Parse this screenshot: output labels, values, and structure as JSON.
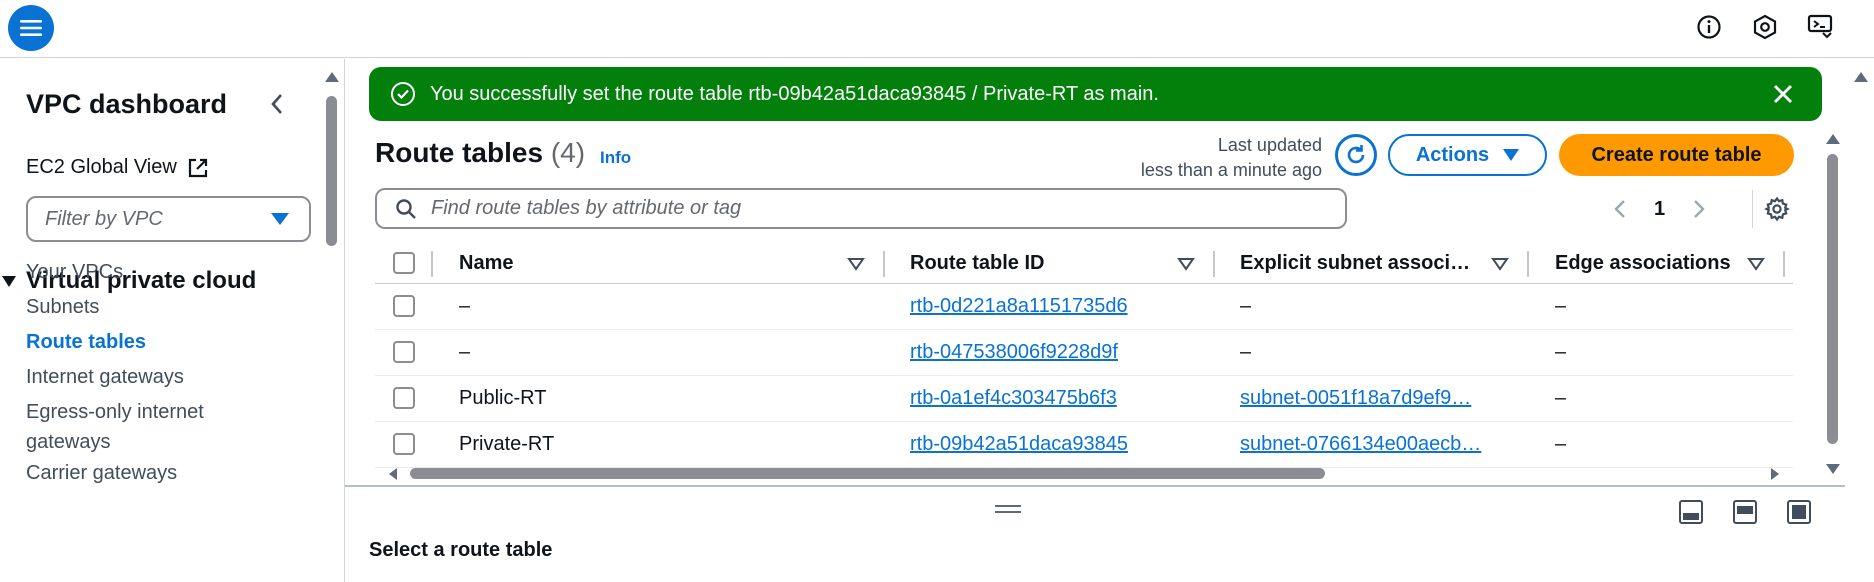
{
  "flash": {
    "message": "You successfully set the route table rtb-09b42a51daca93845 / Private-RT as main."
  },
  "sidebar": {
    "title": "VPC dashboard",
    "ec2_link": "EC2 Global View",
    "filter_placeholder": "Filter by VPC",
    "section_title": "Virtual private cloud",
    "items": [
      {
        "label": "Your VPCs"
      },
      {
        "label": "Subnets"
      },
      {
        "label": "Route tables",
        "active": true
      },
      {
        "label": "Internet gateways"
      },
      {
        "label": "Egress-only internet gateways"
      },
      {
        "label": "Carrier gateways"
      }
    ]
  },
  "header": {
    "title": "Route tables",
    "count": "(4)",
    "info": "Info",
    "last_updated_line1": "Last updated",
    "last_updated_line2": "less than a minute ago",
    "actions_label": "Actions",
    "create_label": "Create route table"
  },
  "search": {
    "placeholder": "Find route tables by attribute or tag"
  },
  "pagination": {
    "current_page": "1"
  },
  "table": {
    "columns": [
      "Name",
      "Route table ID",
      "Explicit subnet associ…",
      "Edge associations"
    ],
    "rows": [
      {
        "name": "–",
        "id": "rtb-0d221a8a1151735d6",
        "subnet": "–",
        "edge": "–"
      },
      {
        "name": "–",
        "id": "rtb-047538006f9228d9f",
        "subnet": "–",
        "edge": "–"
      },
      {
        "name": "Public-RT",
        "id": "rtb-0a1ef4c303475b6f3",
        "subnet": "subnet-0051f18a7d9ef9…",
        "edge": "–"
      },
      {
        "name": "Private-RT",
        "id": "rtb-09b42a51daca93845",
        "subnet": "subnet-0766134e00aecb…",
        "edge": "–"
      }
    ]
  },
  "details": {
    "title": "Select a route table"
  },
  "colors": {
    "accent": "#0972d3",
    "success": "#037f0c",
    "primary_button": "#ff9900"
  }
}
